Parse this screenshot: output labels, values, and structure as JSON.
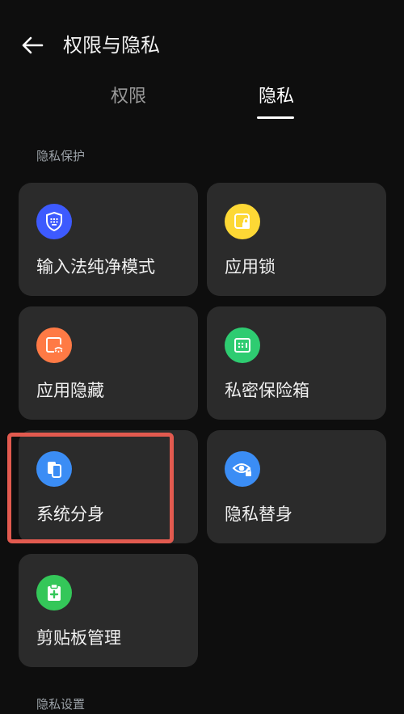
{
  "header": {
    "title": "权限与隐私",
    "back_icon": "back-arrow-icon"
  },
  "tabs": [
    {
      "label": "权限",
      "active": false
    },
    {
      "label": "隐私",
      "active": true
    }
  ],
  "sections": {
    "privacy_protection": "隐私保护",
    "privacy_settings": "隐私设置"
  },
  "cards": [
    {
      "label": "输入法纯净模式",
      "icon": "keyboard-shield-icon",
      "color": "#3d5afe"
    },
    {
      "label": "应用锁",
      "icon": "app-lock-icon",
      "color": "#fdd835"
    },
    {
      "label": "应用隐藏",
      "icon": "app-hide-icon",
      "color": "#ff7a45"
    },
    {
      "label": "私密保险箱",
      "icon": "safe-box-icon",
      "color": "#2ecc71"
    },
    {
      "label": "系统分身",
      "icon": "system-clone-icon",
      "color": "#3b8df5"
    },
    {
      "label": "隐私替身",
      "icon": "privacy-eye-icon",
      "color": "#3b8df5"
    },
    {
      "label": "剪贴板管理",
      "icon": "clipboard-icon",
      "color": "#34c759"
    }
  ],
  "colors": {
    "background": "#0e0e0e",
    "card": "#2b2b2b",
    "highlight": "#e25a4f"
  }
}
